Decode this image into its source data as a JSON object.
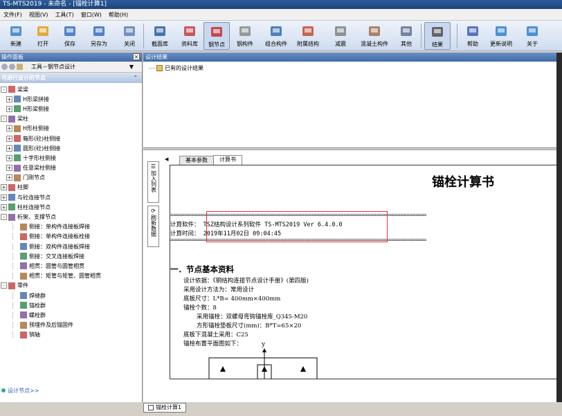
{
  "window": {
    "title": "TS-MTS2019 - 未命名 - [锚栓计算1]"
  },
  "menu": [
    "文件(F)",
    "视图(V)",
    "工具(T)",
    "窗口(W)",
    "帮助(H)"
  ],
  "toolbar": [
    {
      "label": "新建",
      "icon": "new-icon"
    },
    {
      "label": "打开",
      "icon": "open-icon"
    },
    {
      "label": "保存",
      "icon": "save-icon"
    },
    {
      "label": "另存为",
      "icon": "saveas-icon"
    },
    {
      "label": "关闭",
      "icon": "close-icon"
    },
    {
      "label": "截面库",
      "icon": "section-lib-icon"
    },
    {
      "label": "资料库",
      "icon": "data-lib-icon"
    },
    {
      "label": "钢节点",
      "icon": "steel-node-icon",
      "pressed": true
    },
    {
      "label": "钢构件",
      "icon": "steel-member-icon"
    },
    {
      "label": "组合构件",
      "icon": "composite-icon"
    },
    {
      "label": "附属结构",
      "icon": "attached-icon"
    },
    {
      "label": "减震",
      "icon": "damping-icon"
    },
    {
      "label": "混凝土构件",
      "icon": "concrete-icon"
    },
    {
      "label": "其他",
      "icon": "other-icon"
    },
    {
      "label": "结果",
      "icon": "result-icon",
      "pressed": true
    },
    {
      "label": "帮助",
      "icon": "help-icon"
    },
    {
      "label": "更新说明",
      "icon": "update-icon"
    },
    {
      "label": "关于",
      "icon": "about-icon"
    }
  ],
  "left_panel": {
    "header": "操作面板",
    "nav_text": "工具－钢节点设计",
    "section_title": "可进行设计的节点",
    "footer": "设计节点>>",
    "tree": [
      {
        "label": "梁梁",
        "level": 0,
        "expander": "-"
      },
      {
        "label": "H形梁拼接",
        "level": 1,
        "expander": "+"
      },
      {
        "label": "H形梁侧接",
        "level": 1,
        "expander": "+"
      },
      {
        "label": "梁柱",
        "level": 0,
        "expander": "-"
      },
      {
        "label": "H形柱侧接",
        "level": 1,
        "expander": "+"
      },
      {
        "label": "箱形(砼)柱侧接",
        "level": 1,
        "expander": "+"
      },
      {
        "label": "圆形(砼)柱侧接",
        "level": 1,
        "expander": "+"
      },
      {
        "label": "十字形柱侧接",
        "level": 1,
        "expander": "+"
      },
      {
        "label": "任意梁柱侧接",
        "level": 1,
        "expander": "+"
      },
      {
        "label": "门刚节点",
        "level": 1,
        "expander": "+"
      },
      {
        "label": "柱脚",
        "level": 0,
        "expander": "+"
      },
      {
        "label": "与砼连接节点",
        "level": 0,
        "expander": "+"
      },
      {
        "label": "柱柱连接节点",
        "level": 0,
        "expander": "+"
      },
      {
        "label": "桁架、支撑节点",
        "level": 0,
        "expander": "-"
      },
      {
        "label": "侧接：单构件连接板焊接",
        "level": 2,
        "expander": ""
      },
      {
        "label": "侧接：单构件连接板栓接",
        "level": 2,
        "expander": ""
      },
      {
        "label": "侧接：双构件连接板焊接",
        "level": 2,
        "expander": ""
      },
      {
        "label": "侧接：交叉连接板焊接",
        "level": 2,
        "expander": ""
      },
      {
        "label": "相贯：圆管与圆管相贯",
        "level": 2,
        "expander": ""
      },
      {
        "label": "相贯：矩管与矩管、圆管相贯",
        "level": 2,
        "expander": ""
      },
      {
        "label": "零件",
        "level": 0,
        "expander": "-"
      },
      {
        "label": "焊缝群",
        "level": 2,
        "expander": ""
      },
      {
        "label": "锚栓群",
        "level": 2,
        "expander": ""
      },
      {
        "label": "螺栓群",
        "level": 2,
        "expander": ""
      },
      {
        "label": "预埋件及后锚固件",
        "level": 2,
        "expander": ""
      },
      {
        "label": "销轴",
        "level": 2,
        "expander": ""
      }
    ]
  },
  "results_panel": {
    "header": "设计结果",
    "item": "已有的设计结果"
  },
  "doc": {
    "side_tools": [
      "加入列表",
      "刷新数据"
    ],
    "tabs": [
      "基本参数",
      "计算书"
    ],
    "title": "锚栓计算书",
    "separator": "========================================================================================",
    "software_line": "计算软件：    TSZ结构设计系列软件 TS-MTS2019 Ver 6.4.0.0",
    "time_line": "计算时间：    2019年11月02日 09:04:45",
    "section_title": "一．节点基本资料",
    "lines": [
      "设计依据：《钢结构连接节点设计手册》(第四版)",
      "采用设计方法为：常用设计",
      "底板尺寸：L*B= 400mm×400mm",
      "锚栓个数：8",
      "采用锚栓：双螺母弯钩锚栓库_Q345-M20",
      "方形锚栓垫板尺寸(mm)：B*T=65×20",
      "底板下混凝土采用：C25",
      "锚栓布置平面图如下："
    ],
    "axis_label": "y",
    "bottom_tab": "锚栓计算1"
  }
}
